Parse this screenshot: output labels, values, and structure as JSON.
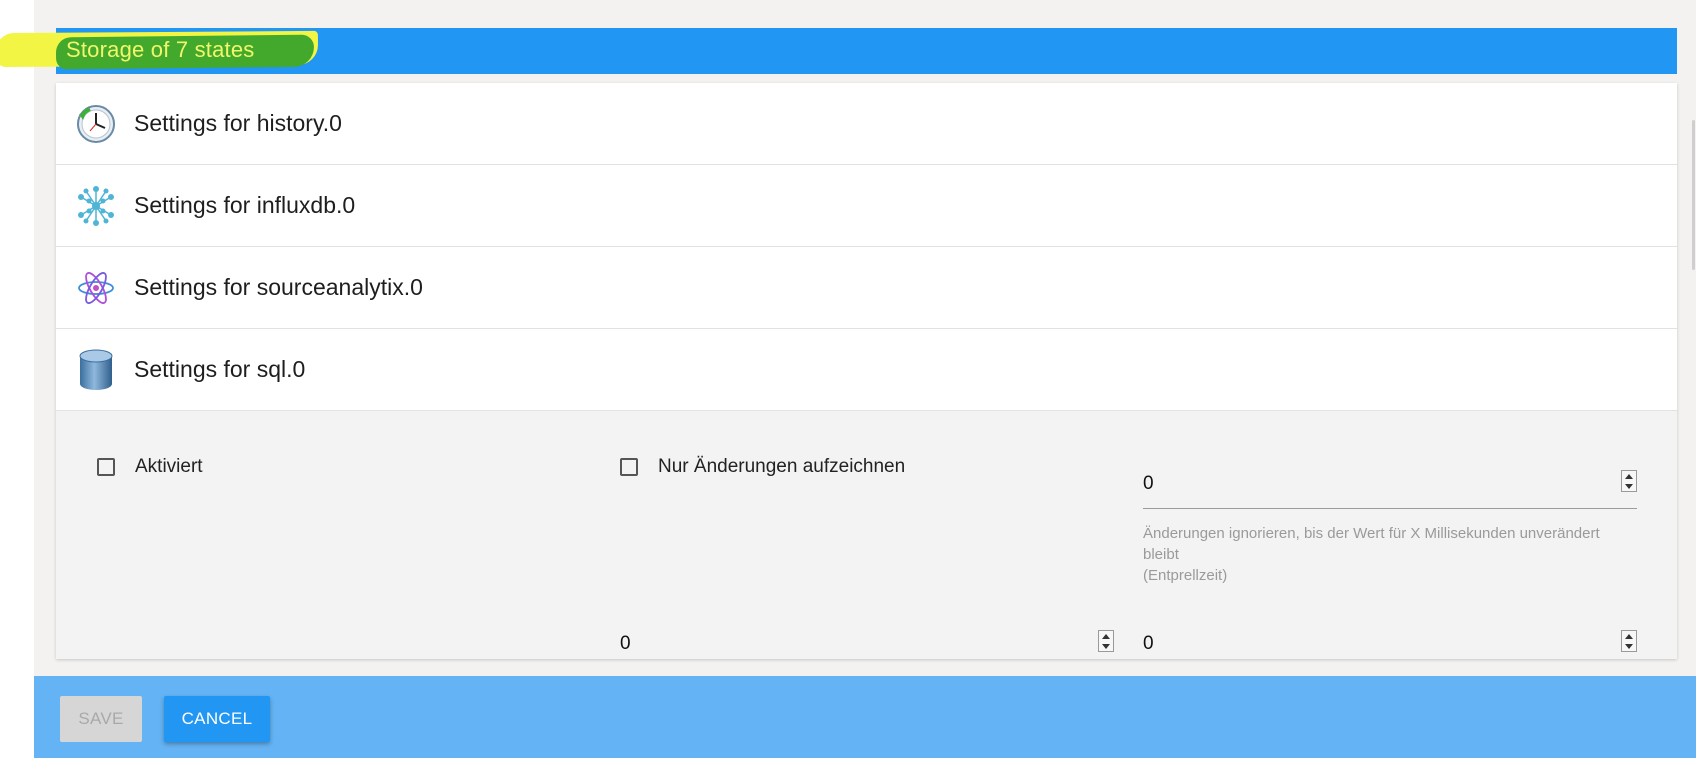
{
  "dialog": {
    "title": "Storage of 7 states"
  },
  "adapters": [
    {
      "label": "Settings for history.0",
      "icon": "history-clock-icon"
    },
    {
      "label": "Settings for influxdb.0",
      "icon": "influxdb-network-icon"
    },
    {
      "label": "Settings for sourceanalytix.0",
      "icon": "sourceanalytix-atom-icon"
    },
    {
      "label": "Settings for sql.0",
      "icon": "sql-database-icon"
    }
  ],
  "sql_settings": {
    "enabled_label": "Aktiviert",
    "enabled_checked": false,
    "changes_only_label": "Nur Änderungen aufzeichnen",
    "changes_only_checked": false,
    "debounce_value": "0",
    "debounce_help_line1": "Änderungen ignorieren, bis der Wert für X Millisekunden unverändert",
    "debounce_help_line2": "bleibt",
    "debounce_help_line3": "(Entprellzeit)",
    "field2_value": "0",
    "field3_value": "0"
  },
  "footer": {
    "save_label": "SAVE",
    "cancel_label": "CANCEL"
  },
  "colors": {
    "primary": "#2196f3",
    "footer": "#64b3f4",
    "highlight_yellow": "#f2f544",
    "highlight_green": "#43a92c"
  }
}
